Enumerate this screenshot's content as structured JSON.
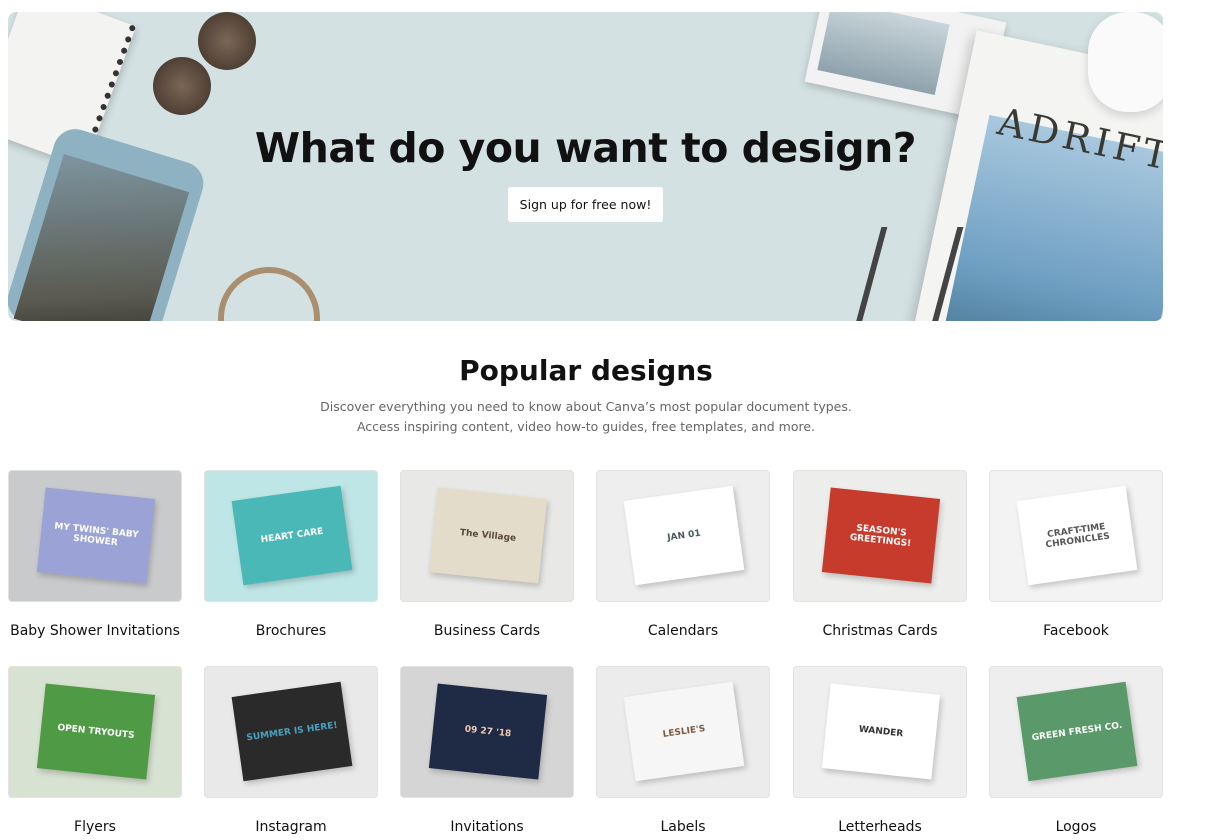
{
  "hero": {
    "title": "What do you want to design?",
    "cta_label": "Sign up for free now!",
    "magazine_title": "ADRIFT"
  },
  "popular": {
    "title": "Popular designs",
    "description": "Discover everything you need to know about Canva’s most popular document types. Access inspiring content, video how-to guides, free templates, and more."
  },
  "designs": [
    {
      "label": "Baby Shower Invitations",
      "thumb_text": "MY TWINS' BABY SHOWER",
      "bg": "#c9cacc",
      "card": "#9ba3d6",
      "fg": "#ffffff"
    },
    {
      "label": "Brochures",
      "thumb_text": "HEART CARE",
      "bg": "#bfe6e6",
      "card": "#4bb8b8",
      "fg": "#ffffff"
    },
    {
      "label": "Business Cards",
      "thumb_text": "The Village",
      "bg": "#e8e8e6",
      "card": "#e3dccb",
      "fg": "#5a4a3a"
    },
    {
      "label": "Calendars",
      "thumb_text": "JAN 01",
      "bg": "#eeeeee",
      "card": "#ffffff",
      "fg": "#4a5a60"
    },
    {
      "label": "Christmas Cards",
      "thumb_text": "SEASON'S GREETINGS!",
      "bg": "#ededeb",
      "card": "#c63b2c",
      "fg": "#ffffff"
    },
    {
      "label": "Facebook",
      "thumb_text": "CRAFT-TIME CHRONICLES",
      "bg": "#f3f3f3",
      "card": "#ffffff",
      "fg": "#555555"
    },
    {
      "label": "Flyers",
      "thumb_text": "OPEN TRYOUTS",
      "bg": "#d8e2d2",
      "card": "#4f9a45",
      "fg": "#ffffff"
    },
    {
      "label": "Instagram",
      "thumb_text": "SUMMER IS HERE!",
      "bg": "#e9e9e9",
      "card": "#2a2a2a",
      "fg": "#4aa0c0"
    },
    {
      "label": "Invitations",
      "thumb_text": "09 27 '18",
      "bg": "#d5d5d5",
      "card": "#1f2a44",
      "fg": "#f0c8b0"
    },
    {
      "label": "Labels",
      "thumb_text": "LESLIE'S",
      "bg": "#ececec",
      "card": "#f6f6f6",
      "fg": "#7a5a40"
    },
    {
      "label": "Letterheads",
      "thumb_text": "WANDER",
      "bg": "#efefef",
      "card": "#ffffff",
      "fg": "#333333"
    },
    {
      "label": "Logos",
      "thumb_text": "GREEN FRESH CO.",
      "bg": "#eeeeee",
      "card": "#5a9a6a",
      "fg": "#ffffff"
    }
  ]
}
